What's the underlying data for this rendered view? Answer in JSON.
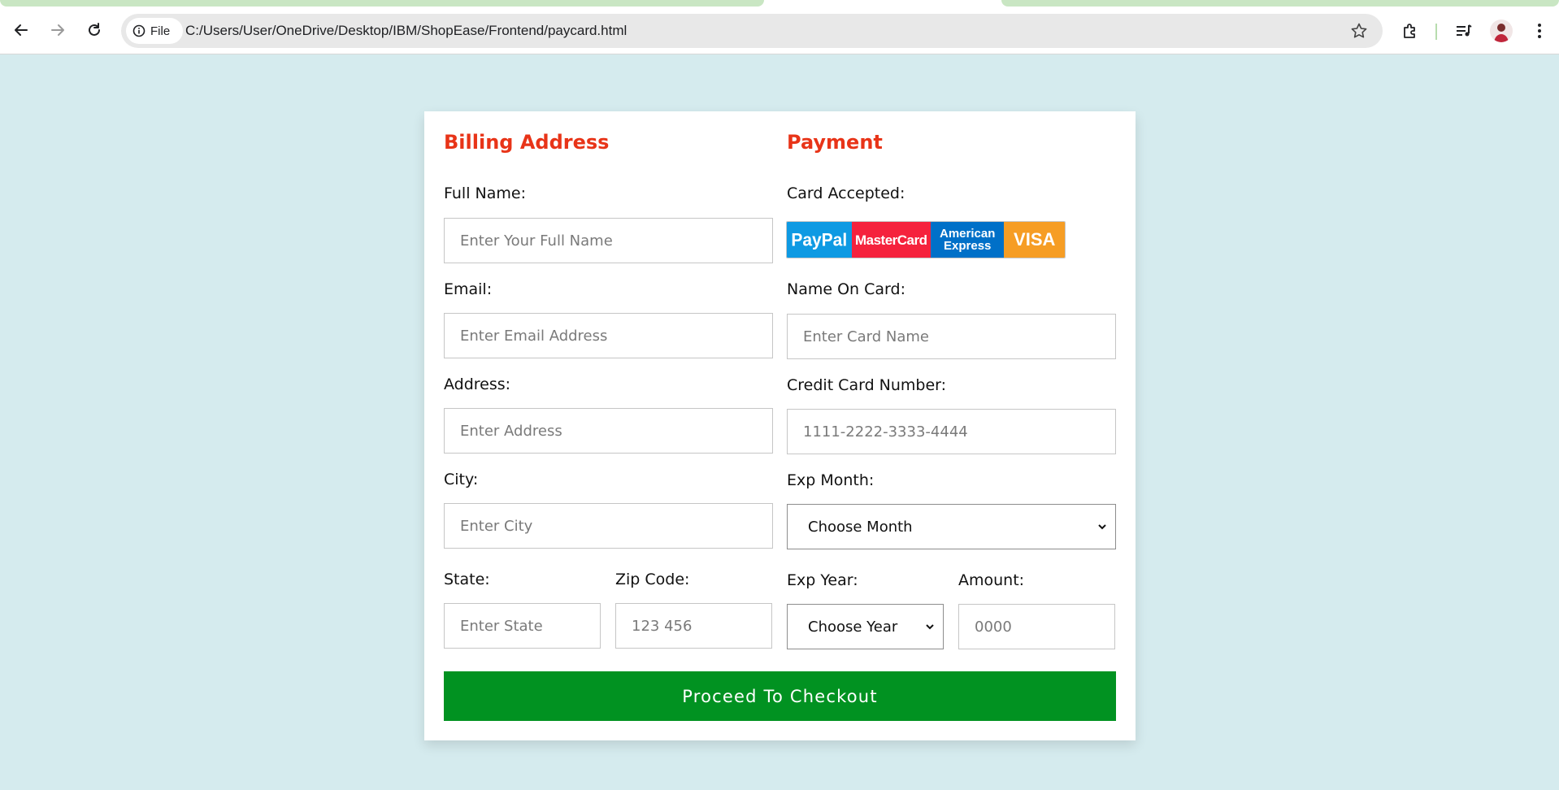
{
  "browser": {
    "file_chip_label": "File",
    "url": "C:/Users/User/OneDrive/Desktop/IBM/ShopEase/Frontend/paycard.html",
    "icons": [
      "back-icon",
      "forward-icon",
      "reload-icon",
      "info-icon",
      "star-icon",
      "extensions-icon",
      "media-control-icon",
      "avatar",
      "kebab-menu-icon"
    ]
  },
  "billing": {
    "title": "Billing Address",
    "full_name": {
      "label": "Full Name:",
      "placeholder": "Enter Your Full Name"
    },
    "email": {
      "label": "Email:",
      "placeholder": "Enter Email Address"
    },
    "address": {
      "label": "Address:",
      "placeholder": "Enter Address"
    },
    "city": {
      "label": "City:",
      "placeholder": "Enter City"
    },
    "state": {
      "label": "State:",
      "placeholder": "Enter State"
    },
    "zip": {
      "label": "Zip Code:",
      "placeholder": "123 456"
    }
  },
  "payment": {
    "title": "Payment",
    "cards_accepted_label": "Card Accepted:",
    "card_brands": [
      "PayPal",
      "MasterCard",
      "American Express",
      "VISA"
    ],
    "name_on_card": {
      "label": "Name On Card:",
      "placeholder": "Enter Card Name"
    },
    "card_number": {
      "label": "Credit Card Number:",
      "placeholder": "1111-2222-3333-4444"
    },
    "exp_month": {
      "label": "Exp Month:",
      "selected": "Choose Month"
    },
    "exp_year": {
      "label": "Exp Year:",
      "selected": "Choose Year"
    },
    "amount": {
      "label": "Amount:",
      "placeholder": "0000"
    }
  },
  "checkout_button": "Proceed To Checkout",
  "colors": {
    "page_background": "#d5ebee",
    "section_title": "#e83418",
    "checkout_button": "#019221",
    "paypal": "#0e9ae3",
    "mastercard": "#f5223d",
    "amex": "#0070c8",
    "visa": "#f69d24"
  }
}
